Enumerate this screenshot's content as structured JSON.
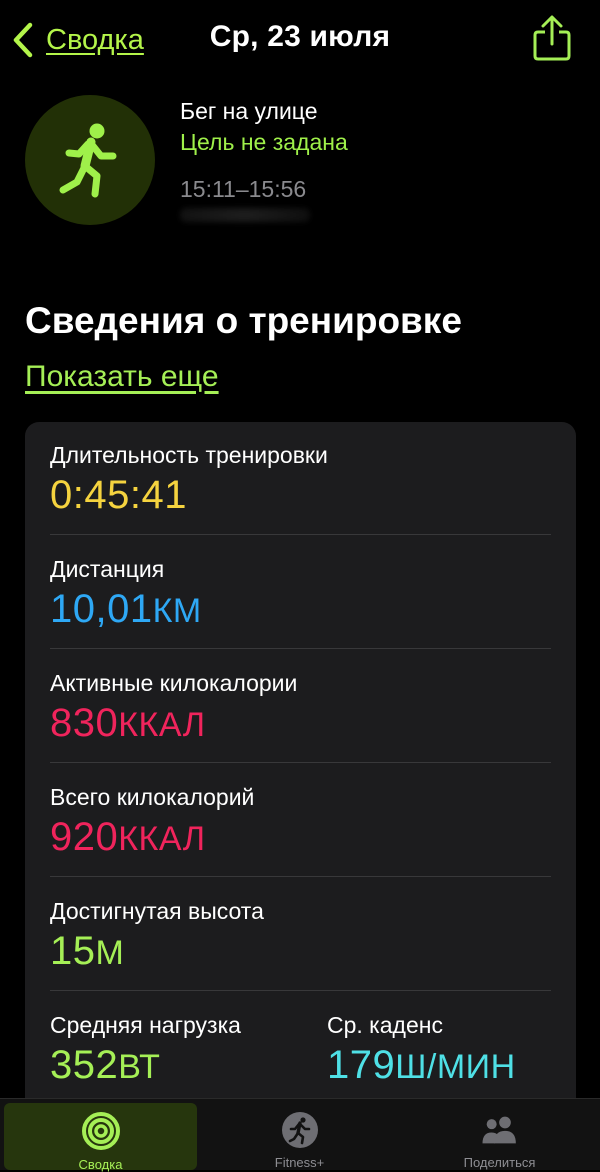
{
  "header": {
    "back_label": "Сводка",
    "title": "Ср, 23 июля"
  },
  "workout": {
    "name": "Бег на улице",
    "goal": "Цель не задана",
    "time_range": "15:11–15:56"
  },
  "details": {
    "title": "Сведения о тренировке",
    "show_more": "Показать еще"
  },
  "metrics": {
    "duration": {
      "label": "Длительность тренировки",
      "value": "0:45:41",
      "unit": ""
    },
    "distance": {
      "label": "Дистанция",
      "value": "10,01",
      "unit": "КМ"
    },
    "active_kcal": {
      "label": "Активные килокалории",
      "value": "830",
      "unit": "ККАЛ"
    },
    "total_kcal": {
      "label": "Всего килокалорий",
      "value": "920",
      "unit": "ККАЛ"
    },
    "elevation": {
      "label": "Достигнутая высота",
      "value": "15",
      "unit": "М"
    },
    "avg_power": {
      "label": "Средняя нагрузка",
      "value": "352",
      "unit": "ВТ"
    },
    "avg_cadence": {
      "label": "Ср. каденс",
      "value": "179",
      "unit": "Ш/МИН"
    }
  },
  "tabs": [
    {
      "label": "Сводка",
      "icon": "activity-rings-icon"
    },
    {
      "label": "Fitness+",
      "icon": "fitness-plus-runner-icon"
    },
    {
      "label": "Поделиться",
      "icon": "people-icon"
    }
  ],
  "colors": {
    "accent_green": "#a5ef56",
    "duration_yellow": "#f5d33f",
    "distance_blue": "#2ea8f5",
    "calories_red": "#f0245c",
    "elevation_green": "#a5ef56",
    "cadence_cyan": "#4fe0e6"
  }
}
